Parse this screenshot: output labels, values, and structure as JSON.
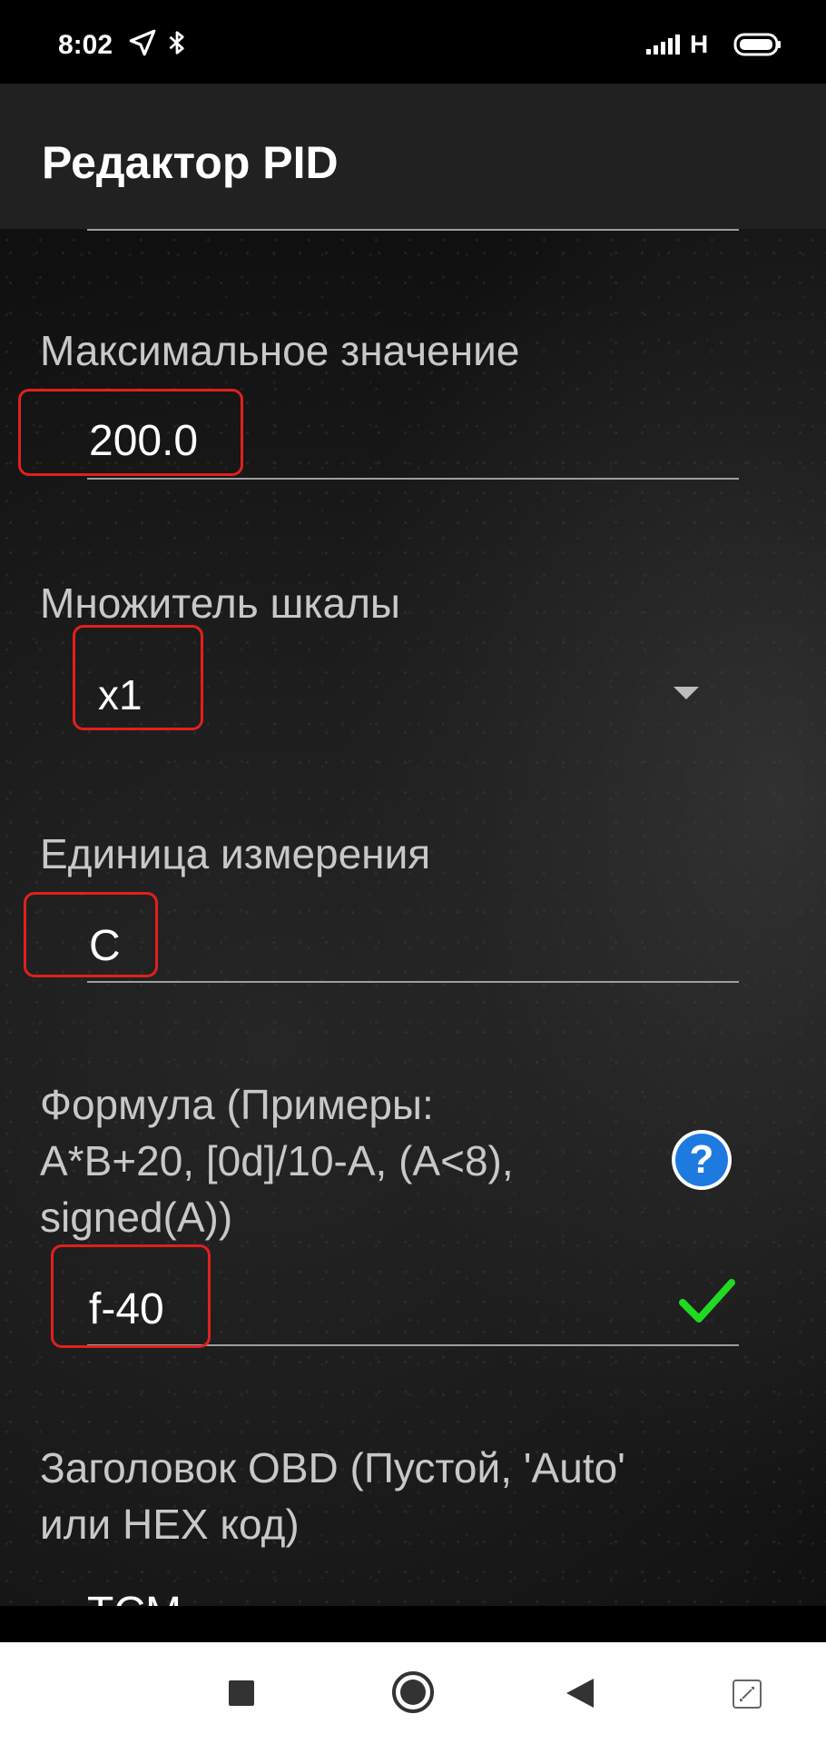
{
  "status_bar": {
    "time": "8:02",
    "network": "H",
    "icons": [
      "location-arrow-icon",
      "bluetooth-icon",
      "signal-icon",
      "battery-icon"
    ]
  },
  "app_bar": {
    "title": "Редактор PID"
  },
  "fields": {
    "max_value": {
      "label": "Максимальное значение",
      "value": "200.0"
    },
    "scale_multiplier": {
      "label": "Множитель шкалы",
      "value": "x1"
    },
    "unit": {
      "label": "Единица измерения",
      "value": "C"
    },
    "formula": {
      "label": "Формула (Примеры: A*B+20, [0d]/10-A, (A<8), signed(A))",
      "label_lines": [
        "Формула (Примеры:",
        "A*B+20, [0d]/10-A, (A<8),",
        "signed(A))"
      ],
      "value": "f-40",
      "help": "?"
    },
    "obd_header": {
      "label_lines": [
        "Заголовок OBD (Пустой, 'Auto'",
        "или HEX код)"
      ],
      "value": "TCM"
    }
  },
  "colors": {
    "highlight": "#e0201f",
    "check": "#22d822",
    "help": "#1f7ae0"
  },
  "nav_bar": {
    "buttons": [
      "recents-square-icon",
      "home-circle-icon",
      "back-triangle-icon",
      "screenshot-expand-icon"
    ]
  }
}
